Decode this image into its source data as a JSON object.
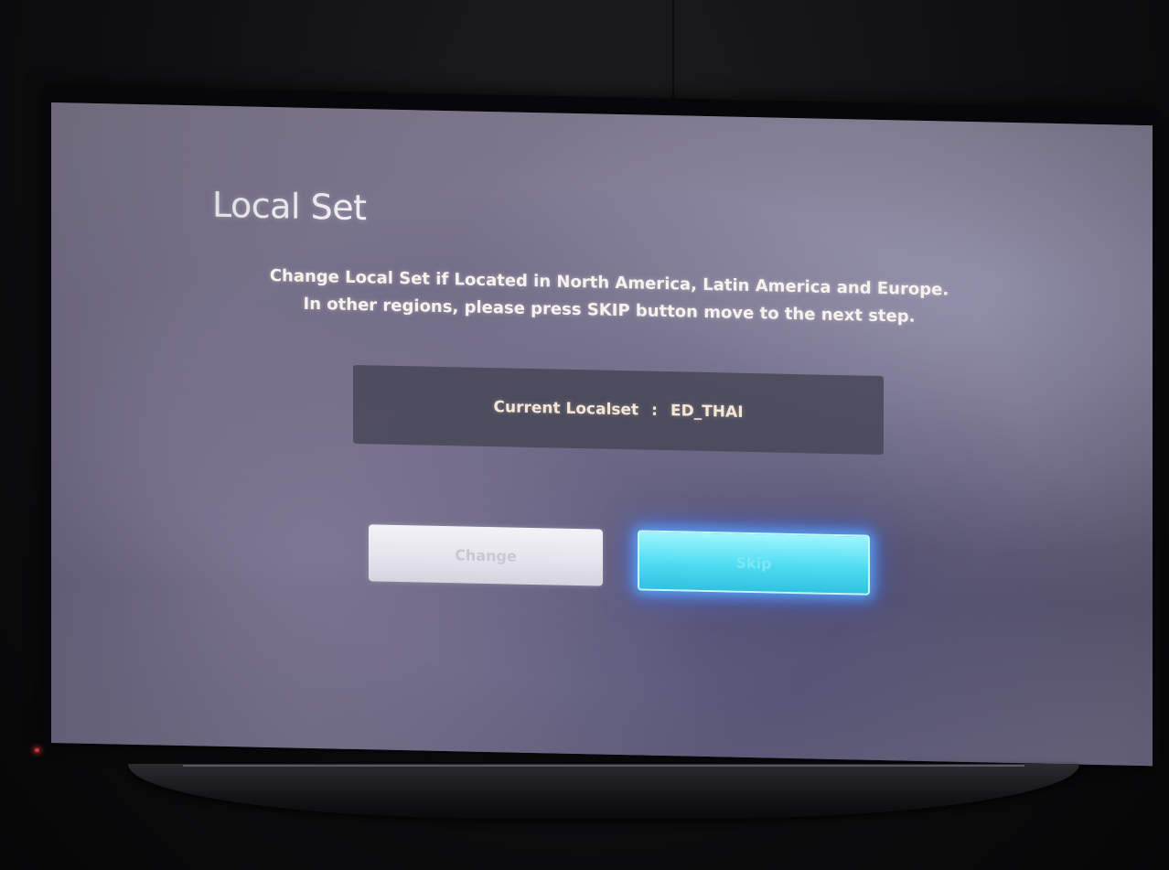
{
  "screen": {
    "title": "Local Set",
    "message_line1": "Change Local Set if Located in North America, Latin America and Europe.",
    "message_line2": "In other regions, please press SKIP button move to the next step.",
    "current_label": "Current Localset",
    "current_separator": ":",
    "current_value": "ED_THAI",
    "change_button": "Change",
    "skip_button": "Skip"
  },
  "colors": {
    "skip_highlight": "#4fdcf2",
    "focus_glow": "#3c64ff",
    "power_led": "#d0383c"
  }
}
